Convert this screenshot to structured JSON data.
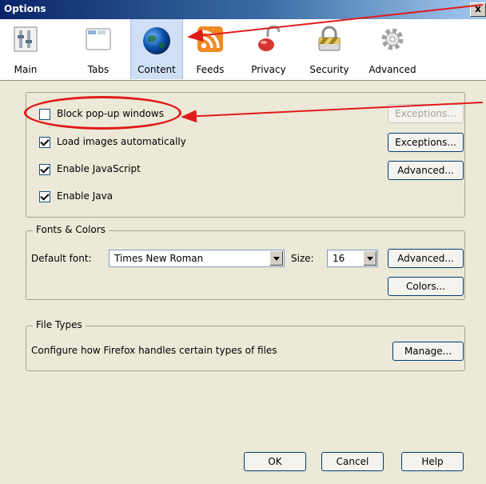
{
  "window": {
    "title": "Options",
    "close_label": "x"
  },
  "tabs": [
    {
      "label": "Main",
      "icon": "main-icon"
    },
    {
      "label": "Tabs",
      "icon": "tabs-icon"
    },
    {
      "label": "Content",
      "icon": "globe-icon",
      "selected": true
    },
    {
      "label": "Feeds",
      "icon": "feed-icon"
    },
    {
      "label": "Privacy",
      "icon": "privacy-icon"
    },
    {
      "label": "Security",
      "icon": "lock-icon"
    },
    {
      "label": "Advanced",
      "icon": "gear-icon"
    }
  ],
  "content_group": {
    "checkboxes": [
      {
        "label": "Block pop-up windows",
        "checked": false
      },
      {
        "label": "Load images automatically",
        "checked": true
      },
      {
        "label": "Enable JavaScript",
        "checked": true
      },
      {
        "label": "Enable Java",
        "checked": true
      }
    ],
    "buttons": {
      "popup_exceptions": "Exceptions...",
      "image_exceptions": "Exceptions...",
      "js_advanced": "Advanced..."
    }
  },
  "fonts_colors": {
    "title": "Fonts & Colors",
    "default_font_label": "Default font:",
    "default_font_value": "Times New Roman",
    "size_label": "Size:",
    "size_value": "16",
    "advanced_button": "Advanced...",
    "colors_button": "Colors..."
  },
  "file_types": {
    "title": "File Types",
    "description": "Configure how Firefox handles certain types of files",
    "manage_button": "Manage..."
  },
  "footer": {
    "ok": "OK",
    "cancel": "Cancel",
    "help": "Help"
  },
  "colors": {
    "annotation": "#e11b1b",
    "selected_tab": "#cfe0f5",
    "dialog_bg": "#ece9d8"
  }
}
